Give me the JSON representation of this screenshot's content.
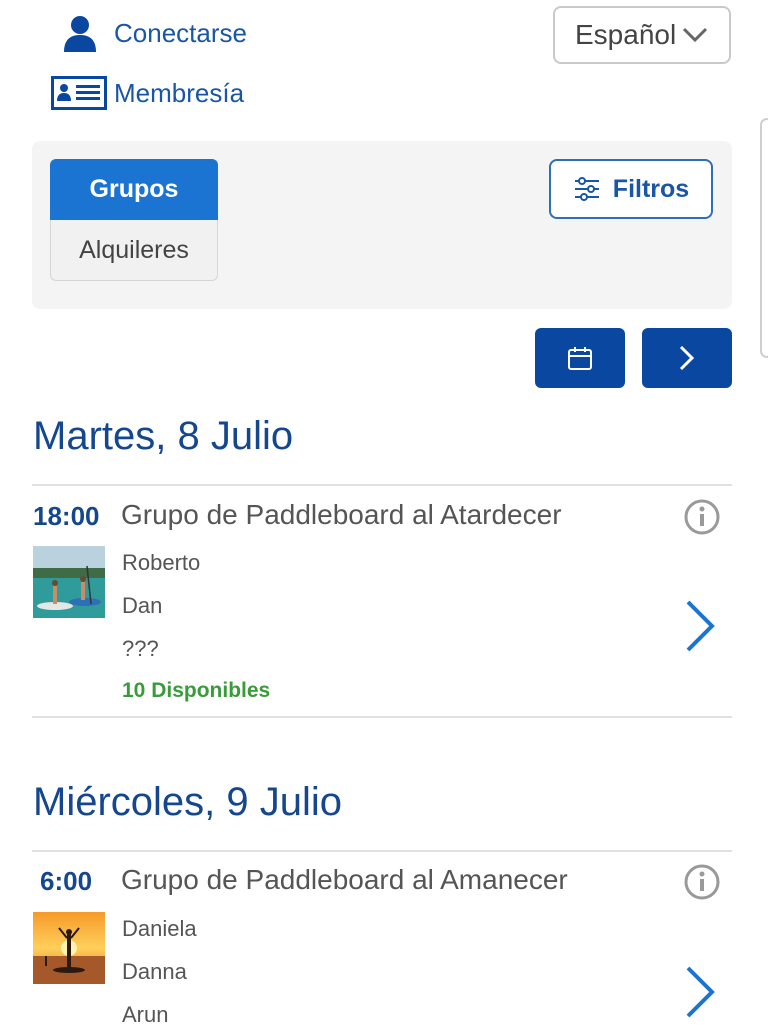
{
  "header": {
    "login_label": "Conectarse",
    "membership_label": "Membresía",
    "language": "Español"
  },
  "tabs": {
    "groups": "Grupos",
    "rentals": "Alquileres"
  },
  "filters_label": "Filtros",
  "colors": {
    "primary": "#1c74d2",
    "dark_blue": "#0a47a0",
    "link_blue": "#1a56a6",
    "available_green": "#3a9b3a"
  },
  "days": [
    {
      "heading": "Martes, 8 Julio",
      "event": {
        "time": "18:00",
        "title": "Grupo de Paddleboard al Atardecer",
        "guides": [
          "Roberto",
          "Dan",
          "???"
        ],
        "availability": "10 Disponibles"
      }
    },
    {
      "heading": "Miércoles, 9 Julio",
      "event": {
        "time": "6:00",
        "title": "Grupo de Paddleboard al Amanecer",
        "guides": [
          "Daniela",
          "Danna",
          "Arun"
        ]
      }
    }
  ]
}
